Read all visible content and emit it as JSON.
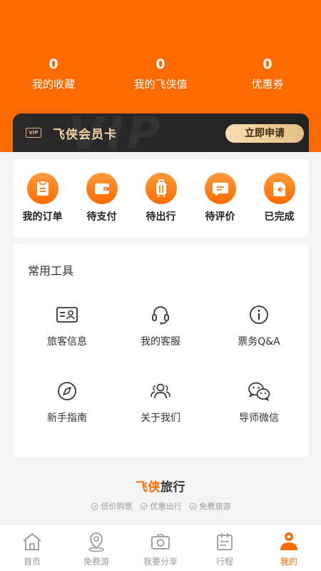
{
  "stats": [
    {
      "value": "0",
      "label": "我的收藏"
    },
    {
      "value": "0",
      "label": "我的飞侠值"
    },
    {
      "value": "0",
      "label": "优惠券"
    }
  ],
  "vip": {
    "badge": "VIP",
    "watermark": "VIP",
    "title": "飞侠会员卡",
    "apply_label": "立即申请"
  },
  "orders": [
    {
      "label": "我的订单",
      "icon": "clipboard-icon"
    },
    {
      "label": "待支付",
      "icon": "wallet-icon"
    },
    {
      "label": "待出行",
      "icon": "suitcase-icon"
    },
    {
      "label": "待评价",
      "icon": "comment-icon"
    },
    {
      "label": "已完成",
      "icon": "return-icon"
    }
  ],
  "tools": {
    "title": "常用工具",
    "items": [
      {
        "label": "旅客信息",
        "icon": "id-card-icon"
      },
      {
        "label": "我的客服",
        "icon": "headset-icon"
      },
      {
        "label": "票务Q&A",
        "icon": "info-icon"
      },
      {
        "label": "新手指南",
        "icon": "compass-icon"
      },
      {
        "label": "关于我们",
        "icon": "users-icon"
      },
      {
        "label": "导师微信",
        "icon": "wechat-icon"
      }
    ]
  },
  "brand": {
    "logo_a": "飞侠",
    "logo_b": "旅行",
    "tags": [
      "低价购票",
      "优惠出行",
      "免费旅游"
    ]
  },
  "tabbar": [
    {
      "label": "首页",
      "icon": "home-icon",
      "active": false
    },
    {
      "label": "免费游",
      "icon": "location-pin-icon",
      "active": false
    },
    {
      "label": "我要分享",
      "icon": "camera-icon",
      "active": false
    },
    {
      "label": "行程",
      "icon": "calendar-icon",
      "active": false
    },
    {
      "label": "我的",
      "icon": "profile-icon",
      "active": true
    }
  ],
  "colors": {
    "accent": "#ff6a00",
    "vip_bg": "#232323",
    "vip_gold": "#f1d3a5"
  }
}
